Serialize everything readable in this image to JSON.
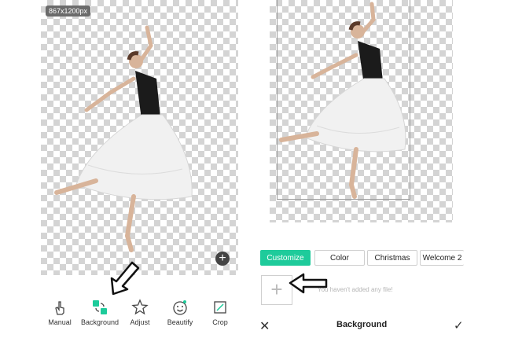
{
  "left_panel": {
    "size_badge": "867x1200px",
    "toolbar": [
      {
        "label": "Manual",
        "icon": "hand-icon"
      },
      {
        "label": "Background",
        "icon": "background-icon"
      },
      {
        "label": "Adjust",
        "icon": "star-outline-icon"
      },
      {
        "label": "Beautify",
        "icon": "smile-icon"
      },
      {
        "label": "Crop",
        "icon": "crop-icon"
      }
    ]
  },
  "right_panel": {
    "tabs": [
      {
        "label": "Customize",
        "active": true
      },
      {
        "label": "Color",
        "active": false
      },
      {
        "label": "Christmas",
        "active": false
      },
      {
        "label": "Welcome 2",
        "active": false
      }
    ],
    "empty_message": "You haven't added any file!",
    "bottom_bar": {
      "title": "Background"
    }
  },
  "colors": {
    "accent": "#1ecb9b",
    "badge_bg": "#6b6b6b"
  }
}
